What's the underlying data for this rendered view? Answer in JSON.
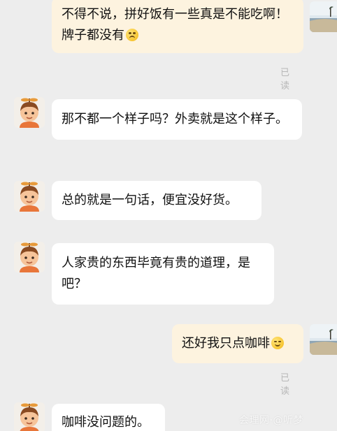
{
  "messages": [
    {
      "side": "out",
      "text": "不得不说，拼好饭有一些真是不能吃啊！牌子都没有",
      "emoji": "worried-face-icon",
      "status": "已读"
    },
    {
      "side": "in",
      "text": "那不都一个样子吗？外卖就是这个样子。"
    },
    {
      "side": "in",
      "text": "总的就是一句话，便宜没好货。"
    },
    {
      "side": "in",
      "text": "人家贵的东西毕竟有贵的道理，是吧？"
    },
    {
      "side": "out",
      "text": "还好我只点咖啡",
      "emoji": "smirk-face-icon",
      "status": "已读"
    },
    {
      "side": "in",
      "text": "咖啡没问题的。"
    }
  ],
  "watermark": "会理网·@听梦",
  "avatars": {
    "other": "cartoon-boy-avatar",
    "self": "beach-landscape-avatar"
  },
  "colors": {
    "background": "#ededed",
    "incoming_bubble": "#ffffff",
    "outgoing_bubble": "#fdf3df",
    "read_status": "#b8b8b8"
  }
}
